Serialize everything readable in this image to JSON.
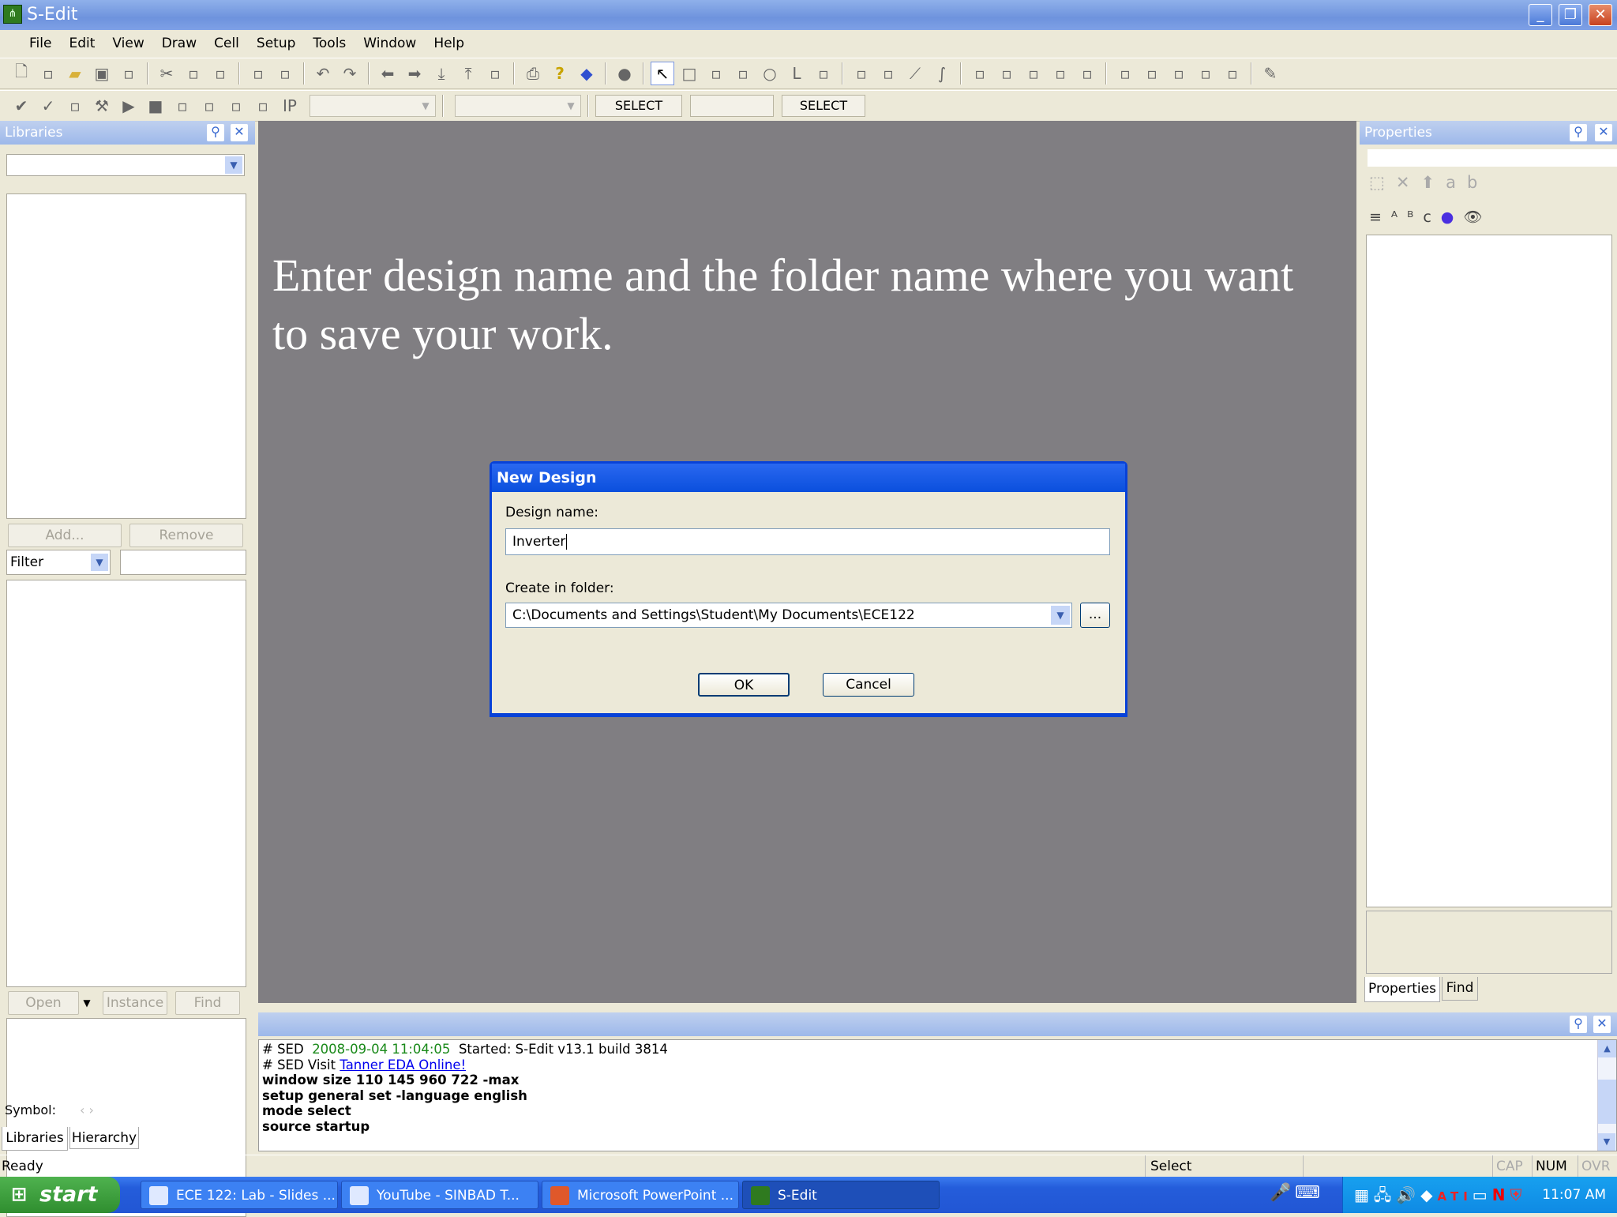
{
  "window": {
    "title": "S-Edit",
    "minimize": "_",
    "restore": "❐",
    "close": "✕"
  },
  "menu": [
    "File",
    "Edit",
    "View",
    "Draw",
    "Cell",
    "Setup",
    "Tools",
    "Window",
    "Help"
  ],
  "toolbar1_icons": [
    "new-file-icon",
    "new-view-icon",
    "open-folder-icon",
    "save-icon",
    "save-all-icon",
    "|",
    "cut-icon",
    "copy-icon",
    "paste-icon",
    "|",
    "open-view-icon",
    "schematic-icon",
    "|",
    "undo-icon",
    "redo-icon",
    "|",
    "back-icon",
    "forward-icon",
    "push-icon",
    "pop-icon",
    "page-icon",
    "|",
    "print-icon",
    "help-icon",
    "book-icon",
    "|",
    "dot-icon",
    "|",
    "pointer-icon",
    "rectangle-icon",
    "polygon-icon",
    "wire-icon",
    "circle-icon",
    "label-icon",
    "instance-icon",
    "|",
    "orthogonal-icon",
    "corner-icon",
    "diagonal-icon",
    "curve-icon",
    "|",
    "bus-icon",
    "net-icon",
    "pin-icon",
    "port-icon",
    "netlabel-icon",
    "|",
    "in-port-icon",
    "out-port-icon",
    "bidir-port-icon",
    "other-port-icon",
    "global-icon",
    "|",
    "pen-icon"
  ],
  "toolbar1_glyphs": {
    "new-file-icon": "🗋",
    "save-icon": "▣",
    "cut-icon": "✂",
    "undo-icon": "↶",
    "redo-icon": "↷",
    "back-icon": "⬅",
    "forward-icon": "➡",
    "push-icon": "⤓",
    "pop-icon": "⤒",
    "print-icon": "⎙",
    "help-icon": "?",
    "dot-icon": "●",
    "pointer-icon": "↖",
    "rectangle-icon": "□",
    "circle-icon": "○",
    "label-icon": "L",
    "diagonal-icon": "⟋",
    "curve-icon": "∫",
    "pen-icon": "✎"
  },
  "toolbar2_icons": [
    "check-icon",
    "check-light-icon",
    "extract-icon",
    "build-icon",
    "run-icon",
    "stop-icon",
    "analyze-icon",
    "probe-v-icon",
    "probe-i-icon",
    "probe-q-icon",
    "ip-icon"
  ],
  "toolbar2_glyphs": {
    "check-icon": "✔",
    "check-light-icon": "✓",
    "build-icon": "⚒",
    "run-icon": "▶",
    "stop-icon": "■",
    "ip-icon": "IP"
  },
  "toolbar2": {
    "select1": "SELECT",
    "select2": "SELECT"
  },
  "libraries": {
    "title": "Libraries",
    "add": "Add...",
    "remove": "Remove",
    "filter": "Filter",
    "open": "Open",
    "instance": "Instance",
    "find": "Find",
    "symbol_label": "Symbol:",
    "tabs": [
      "Libraries",
      "Hierarchy"
    ]
  },
  "properties": {
    "title": "Properties",
    "tabs": [
      "Properties",
      "Find"
    ]
  },
  "canvas": {
    "instruction": "Enter design name and the folder name where you want to save your work."
  },
  "dialog": {
    "title": "New Design",
    "design_name_label": "Design name:",
    "design_name_value": "Inverter",
    "folder_label": "Create in folder:",
    "folder_value": "C:\\Documents and Settings\\Student\\My Documents\\ECE122",
    "browse": "...",
    "ok": "OK",
    "cancel": "Cancel"
  },
  "output": {
    "line1_prefix": "# SED",
    "line1_time": "2008-09-04 11:04:05",
    "line1_msg": "Started: S-Edit v13.1 build 3814",
    "line2_prefix": "# SED  Visit",
    "line2_link": "Tanner EDA Online!",
    "commands": [
      "window size 110 145 960 722 -max",
      "setup general set -language english",
      "mode select",
      "source startup"
    ]
  },
  "status": {
    "left": "Ready",
    "mode": "Select",
    "cap": "CAP",
    "num": "NUM",
    "ovr": "OVR"
  },
  "taskbar": {
    "start": "start",
    "tasks": [
      "ECE 122: Lab - Slides ...",
      "YouTube - SINBAD T...",
      "Microsoft PowerPoint ...",
      "S-Edit"
    ],
    "clock": "11:07 AM"
  }
}
